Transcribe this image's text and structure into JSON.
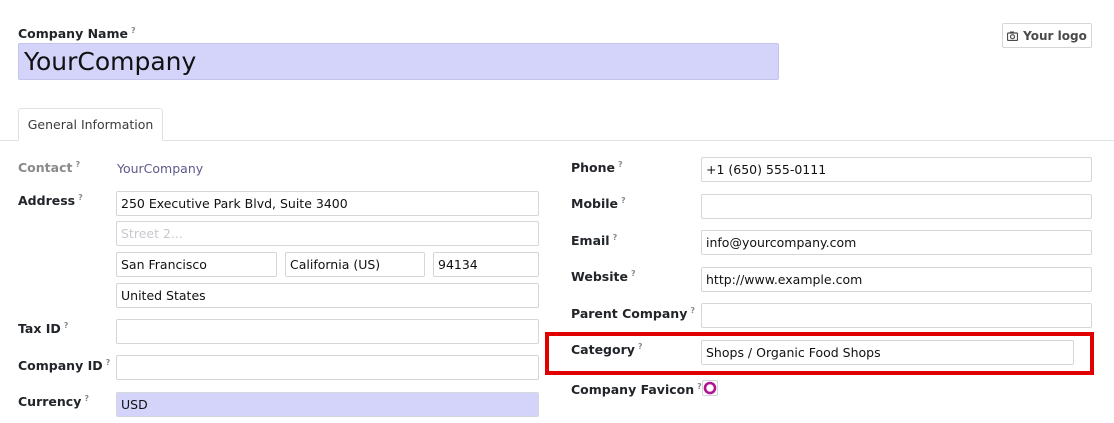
{
  "header": {
    "company_name_label": "Company Name",
    "company_name_value": "YourCompany",
    "logo_button_label": "Your logo"
  },
  "tabs": [
    {
      "label": "General Information",
      "active": true
    }
  ],
  "left": {
    "contact_label": "Contact",
    "contact_value": "YourCompany",
    "address_label": "Address",
    "street": "250 Executive Park Blvd, Suite 3400",
    "street2_placeholder": "Street 2...",
    "city": "San Francisco",
    "state": "California (US)",
    "zip": "94134",
    "country": "United States",
    "tax_id_label": "Tax ID",
    "tax_id_value": "",
    "company_id_label": "Company ID",
    "company_id_value": "",
    "currency_label": "Currency",
    "currency_value": "USD"
  },
  "right": {
    "phone_label": "Phone",
    "phone_value": "+1 (650) 555-0111",
    "mobile_label": "Mobile",
    "mobile_value": "",
    "email_label": "Email",
    "email_value": "info@yourcompany.com",
    "website_label": "Website",
    "website_value": "http://www.example.com",
    "parent_company_label": "Parent Company",
    "parent_company_value": "",
    "category_label": "Category",
    "category_value": "Shops / Organic Food Shops",
    "favicon_label": "Company Favicon"
  },
  "help_mark": "?",
  "colors": {
    "required_field_bg": "#d4d4fb",
    "highlight_border": "#e00000",
    "favicon_ring": "#b0148e",
    "link_text": "#5d5a8a"
  }
}
